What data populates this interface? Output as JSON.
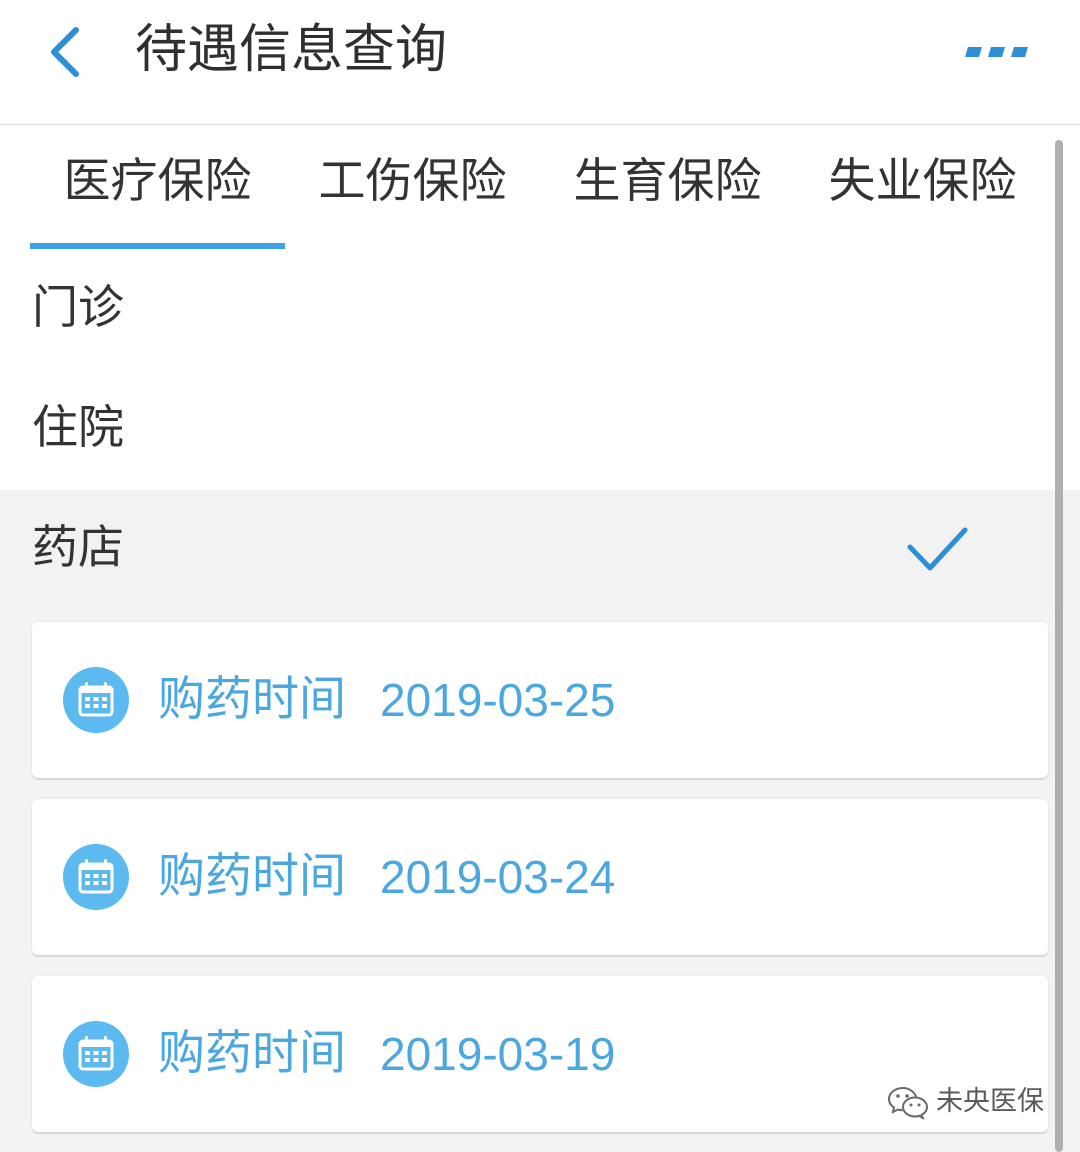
{
  "header": {
    "title": "待遇信息查询",
    "back_icon": "chevron-left-icon",
    "more_icon": "more-dots-icon"
  },
  "tabs": [
    {
      "label": "医疗保险",
      "active": true
    },
    {
      "label": "工伤保险",
      "active": false
    },
    {
      "label": "生育保险",
      "active": false
    },
    {
      "label": "失业保险",
      "active": false
    }
  ],
  "categories": [
    {
      "label": "门诊",
      "selected": false
    },
    {
      "label": "住院",
      "selected": false
    },
    {
      "label": "药店",
      "selected": true
    }
  ],
  "category_selected_icon": "checkmark-icon",
  "records": [
    {
      "label": "购药时间",
      "date": "2019-03-25"
    },
    {
      "label": "购药时间",
      "date": "2019-03-24"
    },
    {
      "label": "购药时间",
      "date": "2019-03-19"
    }
  ],
  "record_icon": "calendar-icon",
  "watermark": {
    "text": "未央医保",
    "icon": "wechat-icon"
  },
  "colors": {
    "accent": "#2e8fd6",
    "tab_indicator": "#3ca3e8",
    "record_text": "#4aa7e0",
    "record_icon_bg": "#5cbaf0",
    "selected_row_bg": "#f2f2f2"
  }
}
